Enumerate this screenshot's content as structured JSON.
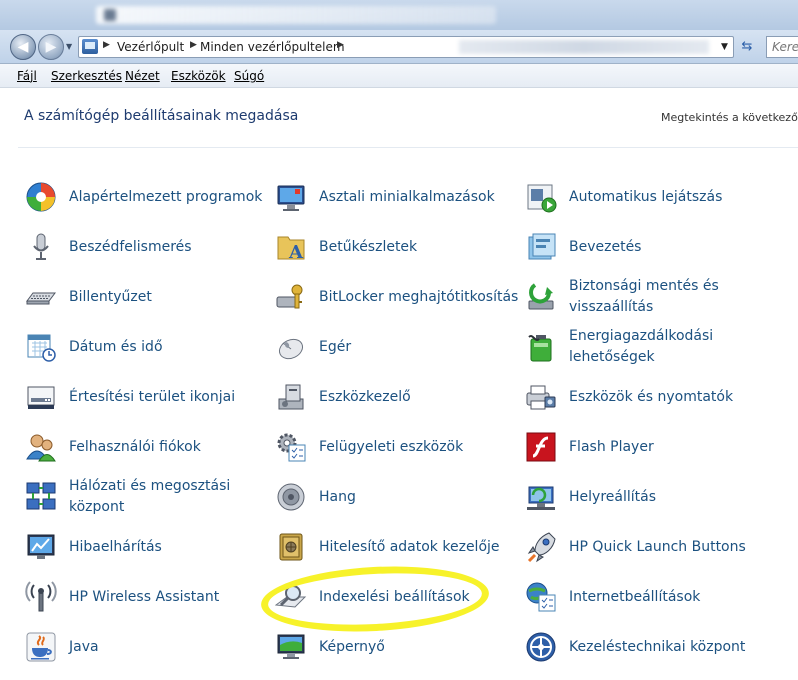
{
  "address": {
    "crumbs": [
      "Vezérlőpult",
      "Minden vezérlőpultelem"
    ],
    "search_placeholder": "Kere"
  },
  "menu": [
    {
      "label": "Fájl"
    },
    {
      "label": "Szerkesztés"
    },
    {
      "label": "Nézet"
    },
    {
      "label": "Eszközök"
    },
    {
      "label": "Súgó"
    }
  ],
  "header": {
    "title": "A számítógép beállításainak megadása",
    "view_label": "Megtekintés a következő sz"
  },
  "items": [
    {
      "label": "Alapértelmezett programok",
      "icon": "default-programs-icon"
    },
    {
      "label": "Asztali minialkalmazások",
      "icon": "desktop-gadgets-icon"
    },
    {
      "label": "Automatikus lejátszás",
      "icon": "autoplay-icon"
    },
    {
      "label": "Beszédfelismerés",
      "icon": "microphone-icon"
    },
    {
      "label": "Betűkészletek",
      "icon": "fonts-folder-icon"
    },
    {
      "label": "Bevezetés",
      "icon": "getting-started-icon"
    },
    {
      "label": "Billentyűzet",
      "icon": "keyboard-icon"
    },
    {
      "label": "BitLocker meghajtótitkosítás",
      "icon": "bitlocker-icon"
    },
    {
      "label": "Biztonsági mentés és visszaállítás",
      "icon": "backup-restore-icon"
    },
    {
      "label": "Dátum és idő",
      "icon": "calendar-clock-icon"
    },
    {
      "label": "Egér",
      "icon": "mouse-icon"
    },
    {
      "label": "Energiagazdálkodási lehetőségek",
      "icon": "power-battery-icon"
    },
    {
      "label": "Értesítési terület ikonjai",
      "icon": "notification-area-icon"
    },
    {
      "label": "Eszközkezelő",
      "icon": "device-manager-icon"
    },
    {
      "label": "Eszközök és nyomtatók",
      "icon": "printer-icon"
    },
    {
      "label": "Felhasználói fiókok",
      "icon": "user-accounts-icon"
    },
    {
      "label": "Felügyeleti eszközök",
      "icon": "admin-tools-icon"
    },
    {
      "label": "Flash Player",
      "icon": "flash-player-icon"
    },
    {
      "label": "Hálózati és megosztási központ",
      "icon": "network-icon"
    },
    {
      "label": "Hang",
      "icon": "speaker-icon"
    },
    {
      "label": "Helyreállítás",
      "icon": "recovery-icon"
    },
    {
      "label": "Hibaelhárítás",
      "icon": "troubleshooting-icon"
    },
    {
      "label": "Hitelesítő adatok kezelője",
      "icon": "credential-vault-icon"
    },
    {
      "label": "HP Quick Launch Buttons",
      "icon": "rocket-icon"
    },
    {
      "label": "HP Wireless Assistant",
      "icon": "wireless-antenna-icon"
    },
    {
      "label": "Indexelési beállítások",
      "icon": "indexing-magnifier-icon"
    },
    {
      "label": "Internetbeállítások",
      "icon": "internet-options-icon"
    },
    {
      "label": "Java",
      "icon": "java-cup-icon"
    },
    {
      "label": "Képernyő",
      "icon": "display-monitor-icon"
    },
    {
      "label": "Kezeléstechnikai központ",
      "icon": "ease-of-access-icon"
    }
  ],
  "annotation": {
    "highlighted_item": "Indexelési beállítások",
    "highlight_color": "#f7f22a"
  }
}
